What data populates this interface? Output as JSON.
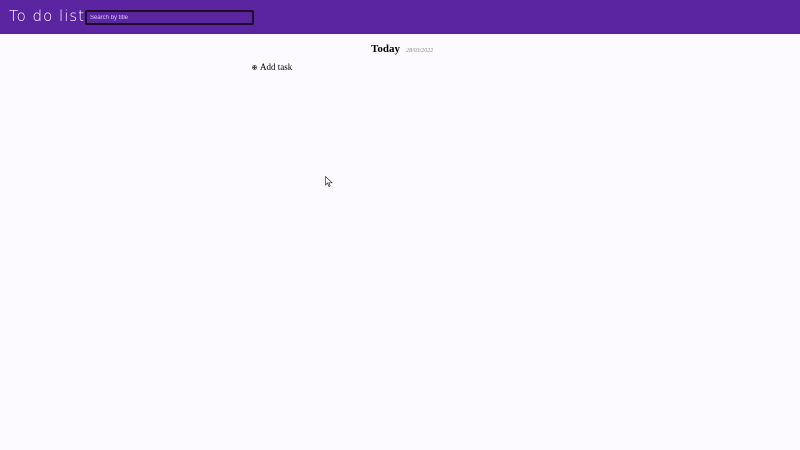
{
  "header": {
    "title": "To do list",
    "search": {
      "placeholder": "Search by title",
      "value": ""
    }
  },
  "main": {
    "section_title": "Today",
    "section_date": "28/03/2022",
    "add_task_label": "Add task"
  },
  "icons": {
    "add_task_icon": "plus-circle-icon",
    "cursor_icon": "mouse-cursor-icon"
  },
  "colors": {
    "header_bg": "#5b25a2",
    "page_bg": "#fcfaff",
    "text": "#000000"
  }
}
